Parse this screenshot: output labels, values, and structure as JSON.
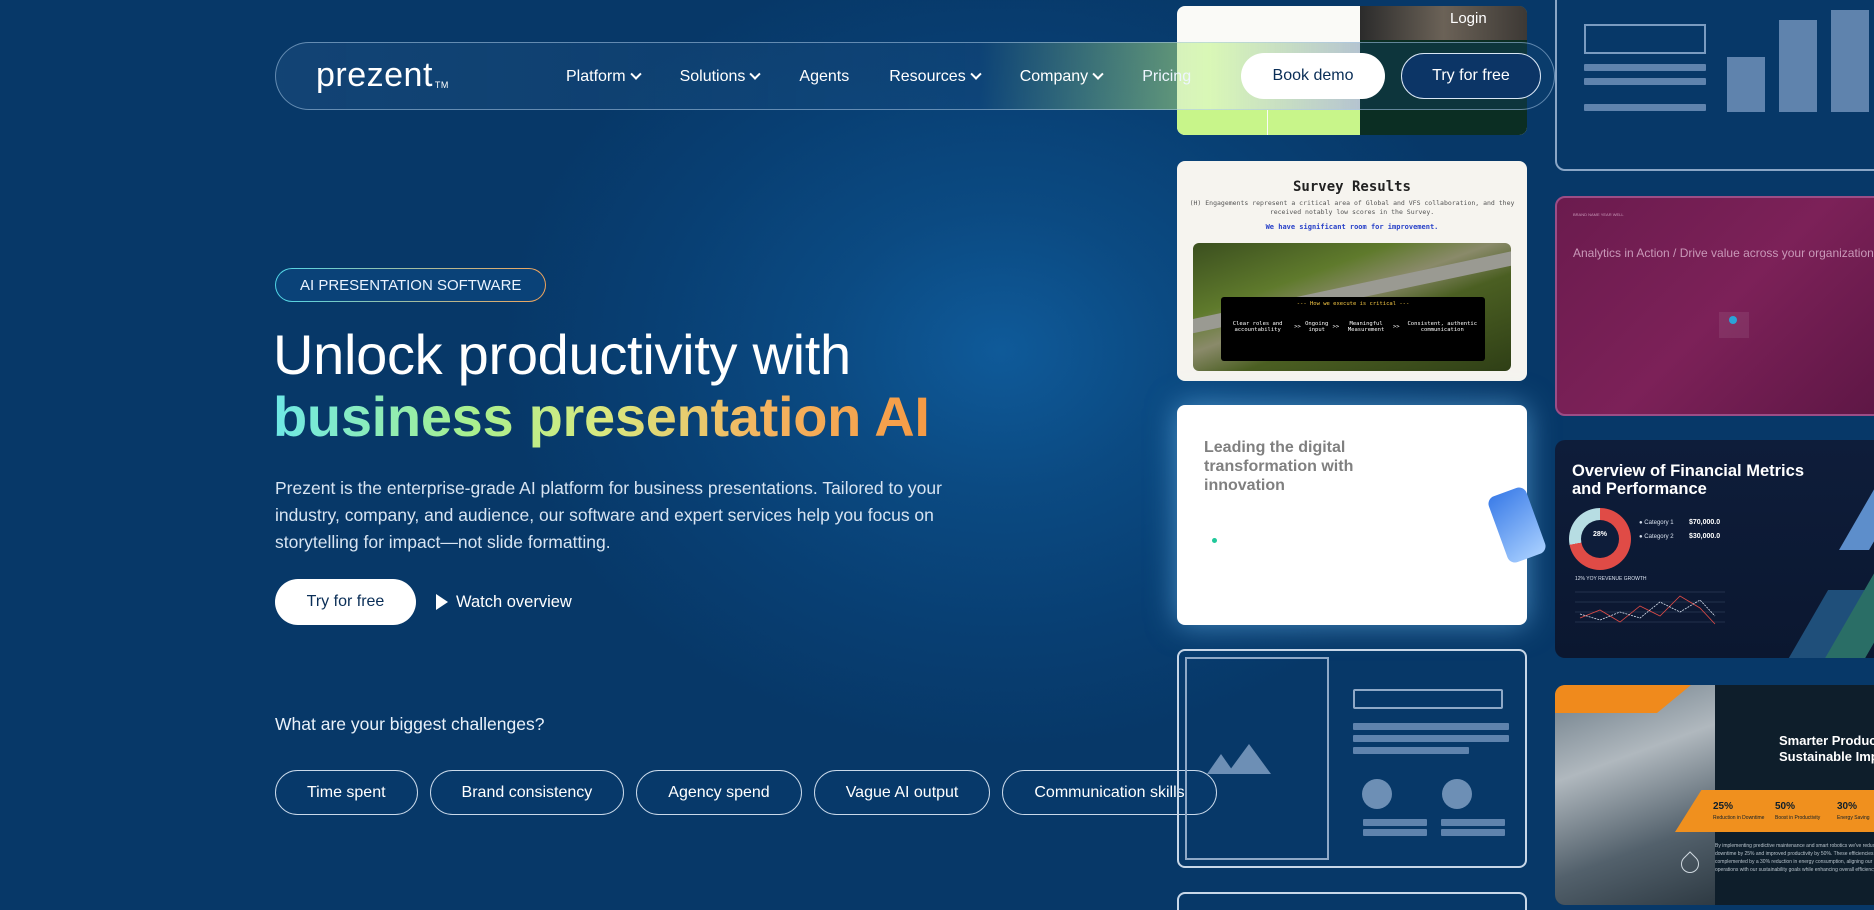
{
  "nav": {
    "logo": "prezent",
    "logo_tm": "TM",
    "items": [
      {
        "label": "Platform",
        "has_dropdown": true
      },
      {
        "label": "Solutions",
        "has_dropdown": true
      },
      {
        "label": "Agents",
        "has_dropdown": false
      },
      {
        "label": "Resources",
        "has_dropdown": true
      },
      {
        "label": "Company",
        "has_dropdown": true
      },
      {
        "label": "Pricing",
        "has_dropdown": false
      }
    ],
    "book_demo": "Book demo",
    "try_free": "Try for free",
    "login": "Login"
  },
  "hero": {
    "badge": "AI PRESENTATION SOFTWARE",
    "title_line1": "Unlock productivity with",
    "title_line2": "business presentation AI",
    "description": "Prezent is the enterprise-grade AI platform for business presentations. Tailored to your industry, company, and audience, our software and expert services help you focus on storytelling for impact—not slide formatting.",
    "cta_primary": "Try for free",
    "cta_secondary": "Watch overview",
    "challenge_question": "What are your biggest challenges?",
    "challenges": [
      "Time spent",
      "Brand consistency",
      "Agency spend",
      "Vague AI output",
      "Communication skills"
    ]
  },
  "slides": {
    "survey": {
      "title": "Survey Results",
      "subtitle": "(H) Engagements represent a critical area of Global and VFS collaboration, and they received notably low scores in the Survey.",
      "highlight": "We have significant room for improvement.",
      "box_title": "--- How we execute is critical ---",
      "steps": [
        "Clear roles and accountability",
        "Ongoing input",
        "Meaningful Measurement",
        "Consistent, authentic communication"
      ],
      "arrow": ">>"
    },
    "leading": {
      "title": "Leading the digital transformation with innovation"
    },
    "analytics": {
      "title": "Analytics in Action / Drive value across your organization",
      "kicker": "BRAND NAME YEAR WELL"
    },
    "financial": {
      "title": "Overview of Financial Metrics and Performance",
      "donut_value": "28%",
      "legend": [
        {
          "label": "Category 1",
          "value": "$70,000.0"
        },
        {
          "label": "Category 2",
          "value": "$30,000.0"
        }
      ],
      "chart_label": "12% YOY REVENUE GROWTH"
    },
    "smarter": {
      "title_line1": "Smarter Productiv",
      "title_line2": "Sustainable Impa",
      "stats": [
        {
          "value": "25%",
          "label": "Reduction in Downtime"
        },
        {
          "value": "50%",
          "label": "Boost in Productivity"
        },
        {
          "value": "30%",
          "label": "Energy Saving"
        }
      ],
      "paragraph": "By implementing predictive maintenance and smart robotics we've reduced downtime by 25% and improved productivity by 50%. These efficiencies are complemented by a 30% reduction in energy consumption, aligning our operations with our sustainability goals while enhancing overall efficiency."
    }
  },
  "colors": {
    "background": "#083f73",
    "accent_gradient_start": "#6ee8e6",
    "accent_gradient_end": "#f59a45",
    "nav_green": "#c8f58a"
  }
}
